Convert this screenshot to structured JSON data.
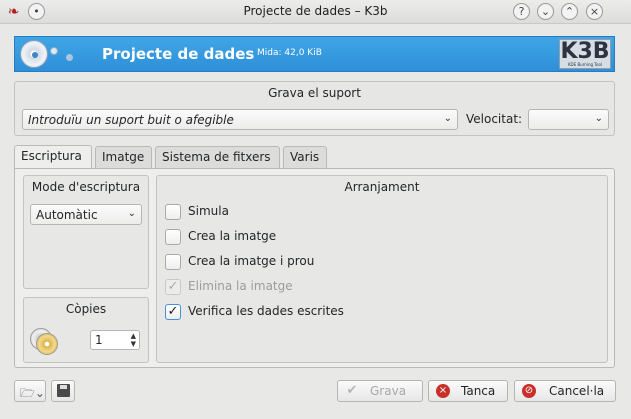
{
  "window": {
    "title": "Projecte de dades – K3b"
  },
  "banner": {
    "title": "Projecte de dades",
    "size_text": "Mida: 42,0 KiB",
    "logo_text": "K3B",
    "logo_subtext": "KDE Burning Tool"
  },
  "burn_medium": {
    "group_title": "Grava el suport",
    "medium_value": "Introduïu un suport buit o afegible",
    "speed_label": "Velocitat:",
    "speed_value": ""
  },
  "tabs": [
    {
      "label": "Escriptura",
      "active": true
    },
    {
      "label": "Imatge",
      "active": false
    },
    {
      "label": "Sistema de fitxers",
      "active": false
    },
    {
      "label": "Varis",
      "active": false
    }
  ],
  "write_mode": {
    "title": "Mode d'escriptura",
    "value": "Automàtic"
  },
  "copies": {
    "title": "Còpies",
    "value": "1"
  },
  "settings": {
    "title": "Arranjament",
    "options": [
      {
        "label": "Simula",
        "checked": false,
        "enabled": true
      },
      {
        "label": "Crea la imatge",
        "checked": false,
        "enabled": true
      },
      {
        "label": "Crea la imatge i prou",
        "checked": false,
        "enabled": true
      },
      {
        "label": "Elimina la imatge",
        "checked": true,
        "enabled": false
      },
      {
        "label": "Verifica les dades escrites",
        "checked": true,
        "enabled": true
      }
    ]
  },
  "buttons": {
    "burn": "Grava",
    "close": "Tanca",
    "cancel": "Cancel·la"
  }
}
